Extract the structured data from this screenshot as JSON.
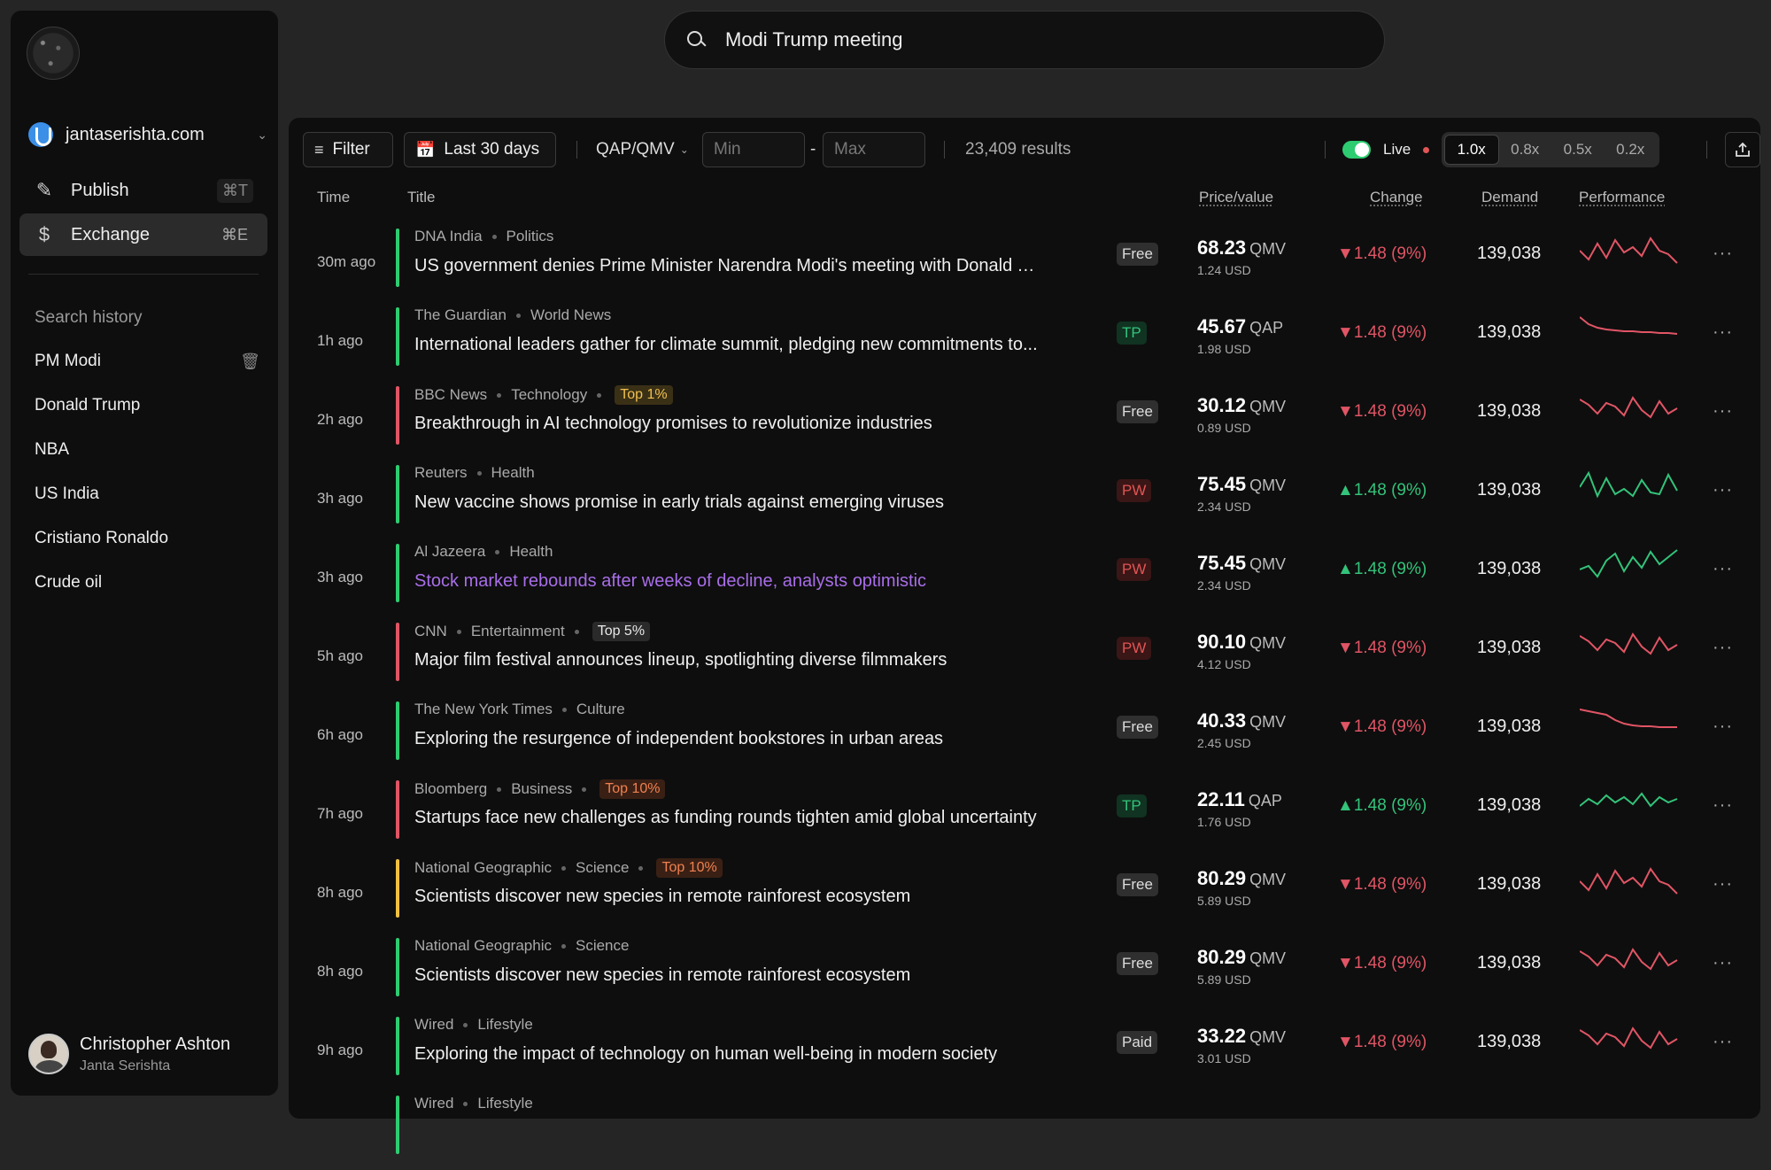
{
  "sidebar": {
    "workspace": "jantaserishta.com",
    "nav": [
      {
        "label": "Publish",
        "kbd": "⌘T"
      },
      {
        "label": "Exchange",
        "kbd": "⌘E"
      }
    ],
    "history_title": "Search history",
    "history": [
      "PM Modi",
      "Donald Trump",
      "NBA",
      "US India",
      "Cristiano Ronaldo",
      "Crude oil"
    ],
    "user": {
      "name": "Christopher Ashton",
      "sub": "Janta Serishta"
    }
  },
  "search": {
    "value": "Modi Trump meeting"
  },
  "toolbar": {
    "filter": "Filter",
    "date": "Last 30 days",
    "unit": "QAP/QMV",
    "min_placeholder": "Min",
    "max_placeholder": "Max",
    "dash": "-",
    "results": "23,409 results",
    "live": "Live",
    "speeds": [
      "1.0x",
      "0.8x",
      "0.5x",
      "0.2x"
    ],
    "selected_speed": "1.0x"
  },
  "table": {
    "headers": {
      "time": "Time",
      "title": "Title",
      "price": "Price/value",
      "change": "Change",
      "demand": "Demand",
      "performance": "Performance"
    },
    "rows": [
      {
        "time": "30m ago",
        "source": "DNA India",
        "category": "Politics",
        "tag": "",
        "title": "US government denies Prime Minister Narendra Modi's meeting with Donald Tr...",
        "badge": "Free",
        "price": "68.23",
        "unit": "QMV",
        "usd": "1.24 USD",
        "change": "1.48 (9%)",
        "dir": "down",
        "demand": "139,038",
        "bar": "#2ecc71"
      },
      {
        "time": "1h ago",
        "source": "The Guardian",
        "category": "World News",
        "tag": "",
        "title": "International leaders gather for climate summit, pledging new commitments to...",
        "badge": "TP",
        "price": "45.67",
        "unit": "QAP",
        "usd": "1.98 USD",
        "change": "1.48 (9%)",
        "dir": "down",
        "demand": "139,038",
        "bar": "#2ecc71"
      },
      {
        "time": "2h ago",
        "source": "BBC News",
        "category": "Technology",
        "tag": "Top 1%",
        "tag_style": "yellow",
        "title": "Breakthrough in AI technology promises to revolutionize industries",
        "badge": "Free",
        "price": "30.12",
        "unit": "QMV",
        "usd": "0.89 USD",
        "change": "1.48 (9%)",
        "dir": "down",
        "demand": "139,038",
        "bar": "#e05565"
      },
      {
        "time": "3h ago",
        "source": "Reuters",
        "category": "Health",
        "tag": "",
        "title": "New vaccine shows promise in early trials against emerging viruses",
        "badge": "PW",
        "price": "75.45",
        "unit": "QMV",
        "usd": "2.34 USD",
        "change": "1.48 (9%)",
        "dir": "up",
        "demand": "139,038",
        "bar": "#2ecc71"
      },
      {
        "time": "3h ago",
        "source": "Al Jazeera",
        "category": "Health",
        "tag": "",
        "title": "Stock market rebounds after weeks of decline, analysts optimistic",
        "title_style": "purple",
        "badge": "PW",
        "price": "75.45",
        "unit": "QMV",
        "usd": "2.34 USD",
        "change": "1.48 (9%)",
        "dir": "up",
        "demand": "139,038",
        "bar": "#2ecc71"
      },
      {
        "time": "5h ago",
        "source": "CNN",
        "category": "Entertainment",
        "tag": "Top 5%",
        "tag_style": "gray",
        "title": "Major film festival announces lineup, spotlighting diverse filmmakers",
        "badge": "PW",
        "price": "90.10",
        "unit": "QMV",
        "usd": "4.12 USD",
        "change": "1.48 (9%)",
        "dir": "down",
        "demand": "139,038",
        "bar": "#e05565"
      },
      {
        "time": "6h ago",
        "source": "The New York Times",
        "category": "Culture",
        "tag": "",
        "title": "Exploring the resurgence of independent bookstores in urban areas",
        "badge": "Free",
        "price": "40.33",
        "unit": "QMV",
        "usd": "2.45 USD",
        "change": "1.48 (9%)",
        "dir": "down",
        "demand": "139,038",
        "bar": "#2ecc71"
      },
      {
        "time": "7h ago",
        "source": "Bloomberg",
        "category": "Business",
        "tag": "Top 10%",
        "tag_style": "orange",
        "title": "Startups face new challenges as funding rounds tighten amid global uncertainty",
        "badge": "TP",
        "price": "22.11",
        "unit": "QAP",
        "usd": "1.76 USD",
        "change": "1.48 (9%)",
        "dir": "up",
        "demand": "139,038",
        "bar": "#e05565"
      },
      {
        "time": "8h ago",
        "source": "National Geographic",
        "category": "Science",
        "tag": "Top 10%",
        "tag_style": "orange",
        "title": "Scientists discover new species in remote rainforest ecosystem",
        "badge": "Free",
        "price": "80.29",
        "unit": "QMV",
        "usd": "5.89 USD",
        "change": "1.48 (9%)",
        "dir": "down",
        "demand": "139,038",
        "bar": "#f0c040"
      },
      {
        "time": "8h ago",
        "source": "National Geographic",
        "category": "Science",
        "tag": "",
        "title": "Scientists discover new species in remote rainforest ecosystem",
        "badge": "Free",
        "price": "80.29",
        "unit": "QMV",
        "usd": "5.89 USD",
        "change": "1.48 (9%)",
        "dir": "down",
        "demand": "139,038",
        "bar": "#2ecc71"
      },
      {
        "time": "9h ago",
        "source": "Wired",
        "category": "Lifestyle",
        "tag": "",
        "title": "Exploring the impact of technology on human well-being in modern society",
        "badge": "Paid",
        "price": "33.22",
        "unit": "QMV",
        "usd": "3.01 USD",
        "change": "1.48 (9%)",
        "dir": "down",
        "demand": "139,038",
        "bar": "#2ecc71"
      },
      {
        "time": "",
        "source": "Wired",
        "category": "Lifestyle",
        "tag": "",
        "title": "",
        "badge": "",
        "price": "",
        "unit": "",
        "usd": "",
        "change": "",
        "dir": "down",
        "demand": "",
        "bar": "#2ecc71"
      }
    ]
  },
  "icons": {
    "filter": "filter-icon",
    "calendar": "calendar-icon",
    "export": "export-icon",
    "more": "more-icon"
  },
  "colors": {
    "up": "#33c37a",
    "down": "#e05565",
    "live": "#2ecc71"
  }
}
